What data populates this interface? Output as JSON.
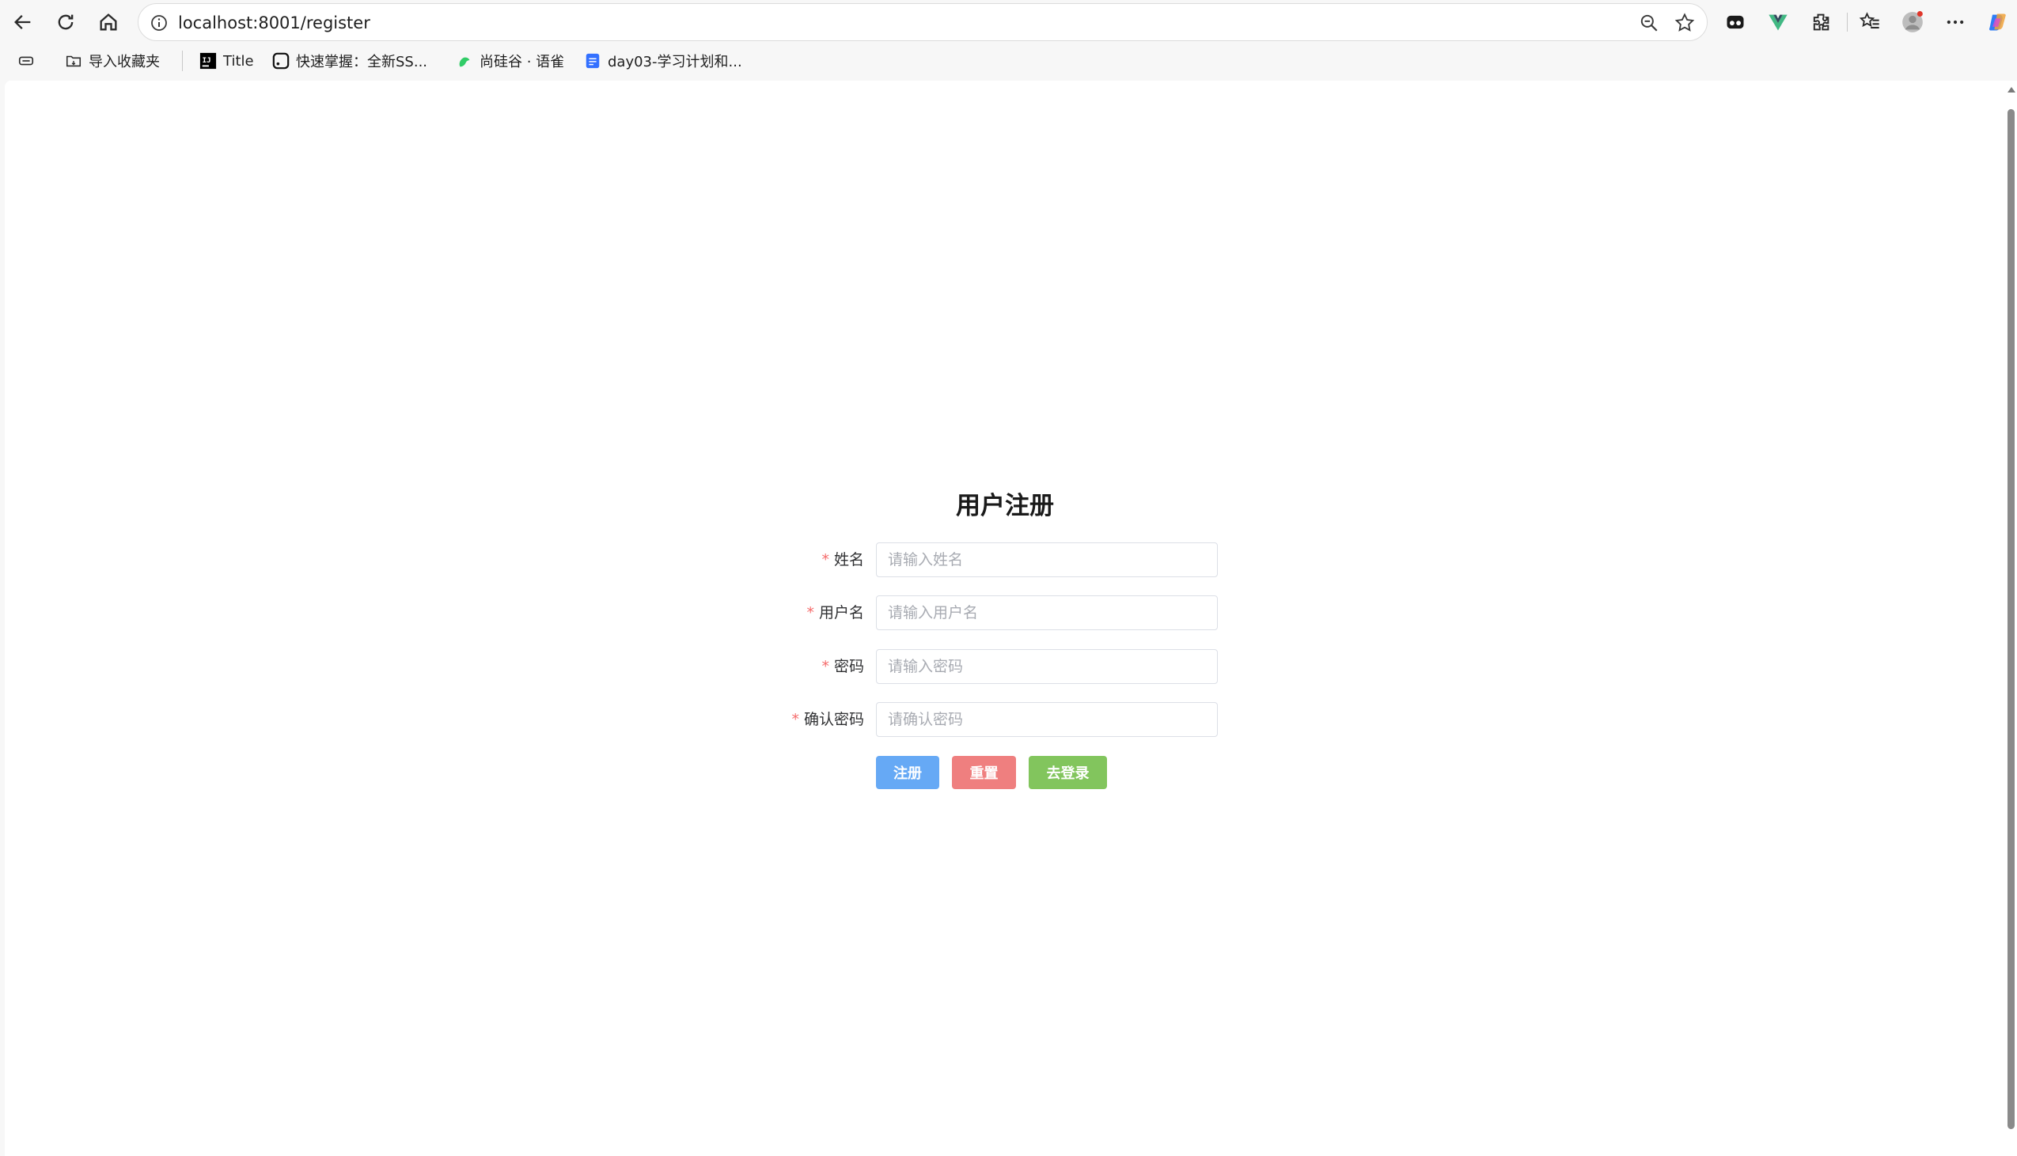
{
  "browser": {
    "url": "localhost:8001/register",
    "bookmarks": [
      {
        "label": "导入收藏夹",
        "icon": "import-folder-icon"
      },
      {
        "label": "Title",
        "icon": "ij-icon"
      },
      {
        "label": "快速掌握：全新SS...",
        "icon": "square-logo-icon"
      },
      {
        "label": "尚硅谷 · 语雀",
        "icon": "yuque-icon"
      },
      {
        "label": "day03-学习计划和...",
        "icon": "doc-icon"
      }
    ]
  },
  "form": {
    "title": "用户注册",
    "required_mark": "*",
    "fields": [
      {
        "label": "姓名",
        "placeholder": "请输入姓名",
        "value": ""
      },
      {
        "label": "用户名",
        "placeholder": "请输入用户名",
        "value": ""
      },
      {
        "label": "密码",
        "placeholder": "请输入密码",
        "value": ""
      },
      {
        "label": "确认密码",
        "placeholder": "请确认密码",
        "value": ""
      }
    ],
    "buttons": {
      "register": "注册",
      "reset": "重置",
      "go_login": "去登录"
    }
  },
  "colors": {
    "primary": "#66a9f5",
    "danger": "#ef7f7f",
    "success": "#82c55d",
    "required": "#f56c6c"
  }
}
